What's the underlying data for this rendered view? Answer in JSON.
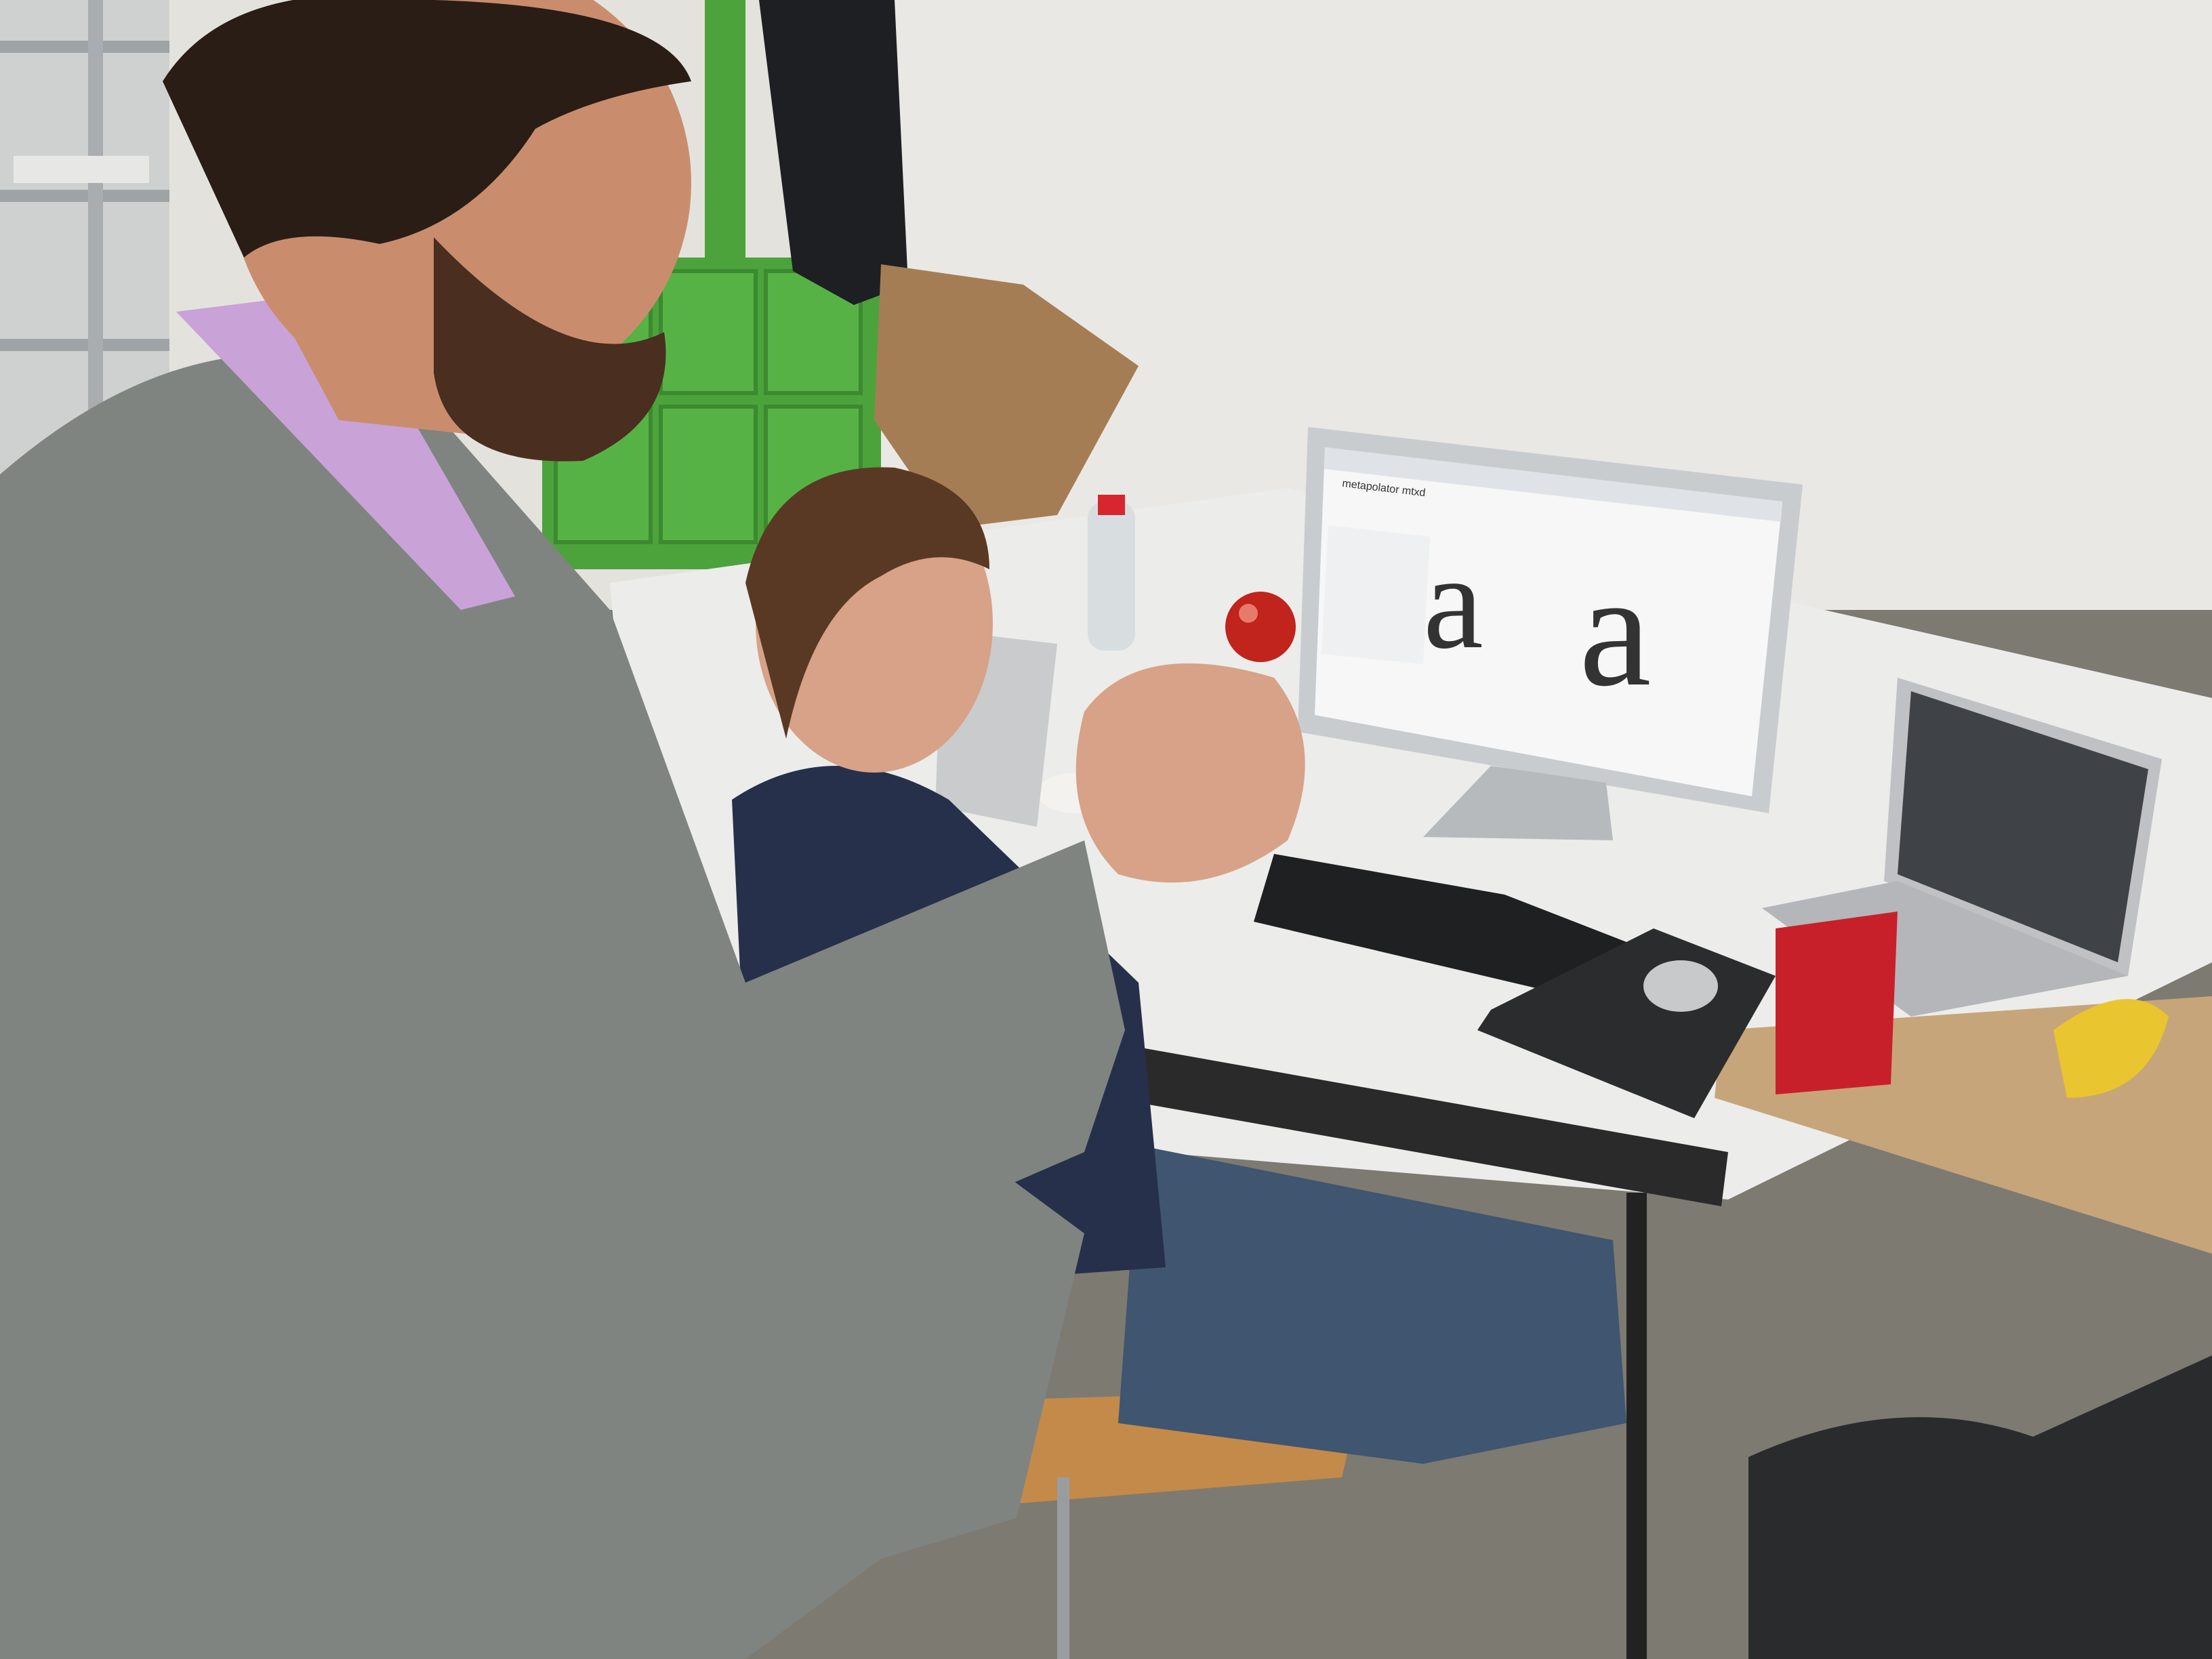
{
  "scene": {
    "type": "photograph",
    "subject": "two men at a desk looking at a monitor showing a typeface editor",
    "colors": {
      "wall": "#e6e4df",
      "floor": "#7d7a72",
      "jacket": "#7f8480",
      "tshirt": "#27304a",
      "jeans": "#3f5570",
      "desk": "#ececea",
      "monitor_bezel": "#c9cccf",
      "screen": "#f7f7f7",
      "chocolate": "#c0241c",
      "lockers": "#4ca33c",
      "box": "#c8202a",
      "banana": "#e9c530"
    }
  },
  "monitor": {
    "window_title": "metapolator mtxd",
    "glyphs": [
      "a",
      "a"
    ]
  }
}
